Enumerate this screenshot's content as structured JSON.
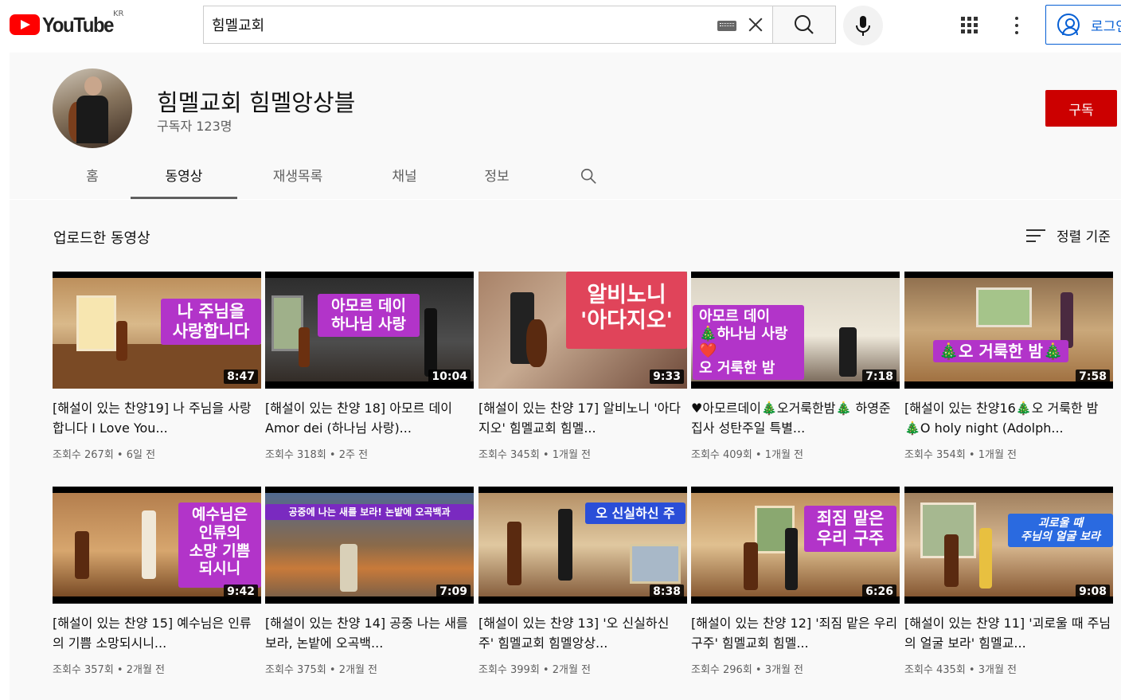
{
  "masthead": {
    "logo_text": "YouTube",
    "country_code": "KR",
    "search_value": "힘멜교회",
    "signin_label": "로그인"
  },
  "channel": {
    "name": "힘멜교회 힘멜앙상블",
    "subscribers": "구독자 123명",
    "subscribe_label": "구독"
  },
  "tabs": [
    "홈",
    "동영상",
    "재생목록",
    "채널",
    "정보"
  ],
  "content": {
    "section_title": "업로드한 동영상",
    "sort_label": "정렬 기준"
  },
  "videos": [
    {
      "title": "[해설이 있는 찬양19] 나 주님을 사랑합니다 I Love You...",
      "meta": "조회수 267회 • 6일 전",
      "duration": "8:47",
      "overlay": "나 주님을\n사랑합니다"
    },
    {
      "title": "[해설이 있는 찬양 18] 아모르 데이 Amor dei (하나님 사랑)...",
      "meta": "조회수 318회 • 2주 전",
      "duration": "10:04",
      "overlay": "아모르 데이\n하나님 사랑"
    },
    {
      "title": "[해설이 있는 찬양 17] 알비노니 '아다지오' 힘멜교회 힘멜...",
      "meta": "조회수 345회 • 1개월 전",
      "duration": "9:33",
      "overlay": "알비노니\n'아다지오'"
    },
    {
      "title": "♥아모르데이🎄오거룩한밤🎄 하영준 집사 성탄주일 특별...",
      "meta": "조회수 409회 • 1개월 전",
      "duration": "7:18",
      "overlay": "아모르 데이\n🎄하나님 사랑❤️\n오 거룩한 밤"
    },
    {
      "title": "[해설이 있는 찬양16🎄오 거룩한 밤🎄O holy night (Adolph...",
      "meta": "조회수 354회 • 1개월 전",
      "duration": "7:58",
      "overlay": "🎄오 거룩한 밤🎄"
    },
    {
      "title": "[해설이 있는 찬양 15] 예수님은 인류의 기쁨 소망되시니...",
      "meta": "조회수 357회 • 2개월 전",
      "duration": "9:42",
      "overlay": "예수님은\n인류의\n소망 기쁨\n되시니"
    },
    {
      "title": "[해설이 있는 찬양 14] 공중 나는 새를 보라, 논밭에 오곡백...",
      "meta": "조회수 375회 • 2개월 전",
      "duration": "7:09",
      "overlay": "공중에 나는 새를 보라! 논밭에 오곡백과"
    },
    {
      "title": "[해설이 있는 찬양 13] '오 신실하신 주' 힘멜교회 힘멜앙상...",
      "meta": "조회수 399회 • 2개월 전",
      "duration": "8:38",
      "overlay": "오 신실하신 주"
    },
    {
      "title": "[해설이 있는 찬양 12] '죄짐 맡은 우리 구주' 힘멜교회 힘멜...",
      "meta": "조회수 296회 • 3개월 전",
      "duration": "6:26",
      "overlay": "죄짐 맡은\n우리 구주"
    },
    {
      "title": "[해설이 있는 찬양 11] '괴로울 때 주님의 얼굴 보라' 힘멜교...",
      "meta": "조회수 435회 • 3개월 전",
      "duration": "9:08",
      "overlay": "괴로울 때\n주님의 얼굴 보라"
    }
  ],
  "colors": {
    "brand_red": "#ff0000",
    "subscribe_red": "#cc0000",
    "link_blue": "#065fd4"
  }
}
